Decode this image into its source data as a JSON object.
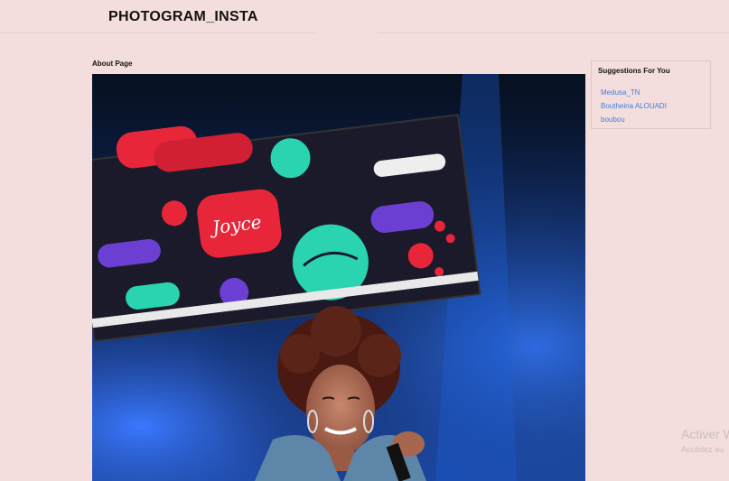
{
  "header": {
    "brand": "PHOTOGRAM_INSTA"
  },
  "main": {
    "page_label": "About Page",
    "photo_alt": "concert photo"
  },
  "sidebar": {
    "title": "Suggestions For You",
    "suggestions": [
      "Medusa_TN",
      "Boutheina ALOUADI",
      "boubou"
    ]
  },
  "watermark": {
    "line1": "Activer W",
    "line2": "Accédez au"
  },
  "colors": {
    "background": "#f4dedd",
    "link": "#3f7fe0"
  }
}
